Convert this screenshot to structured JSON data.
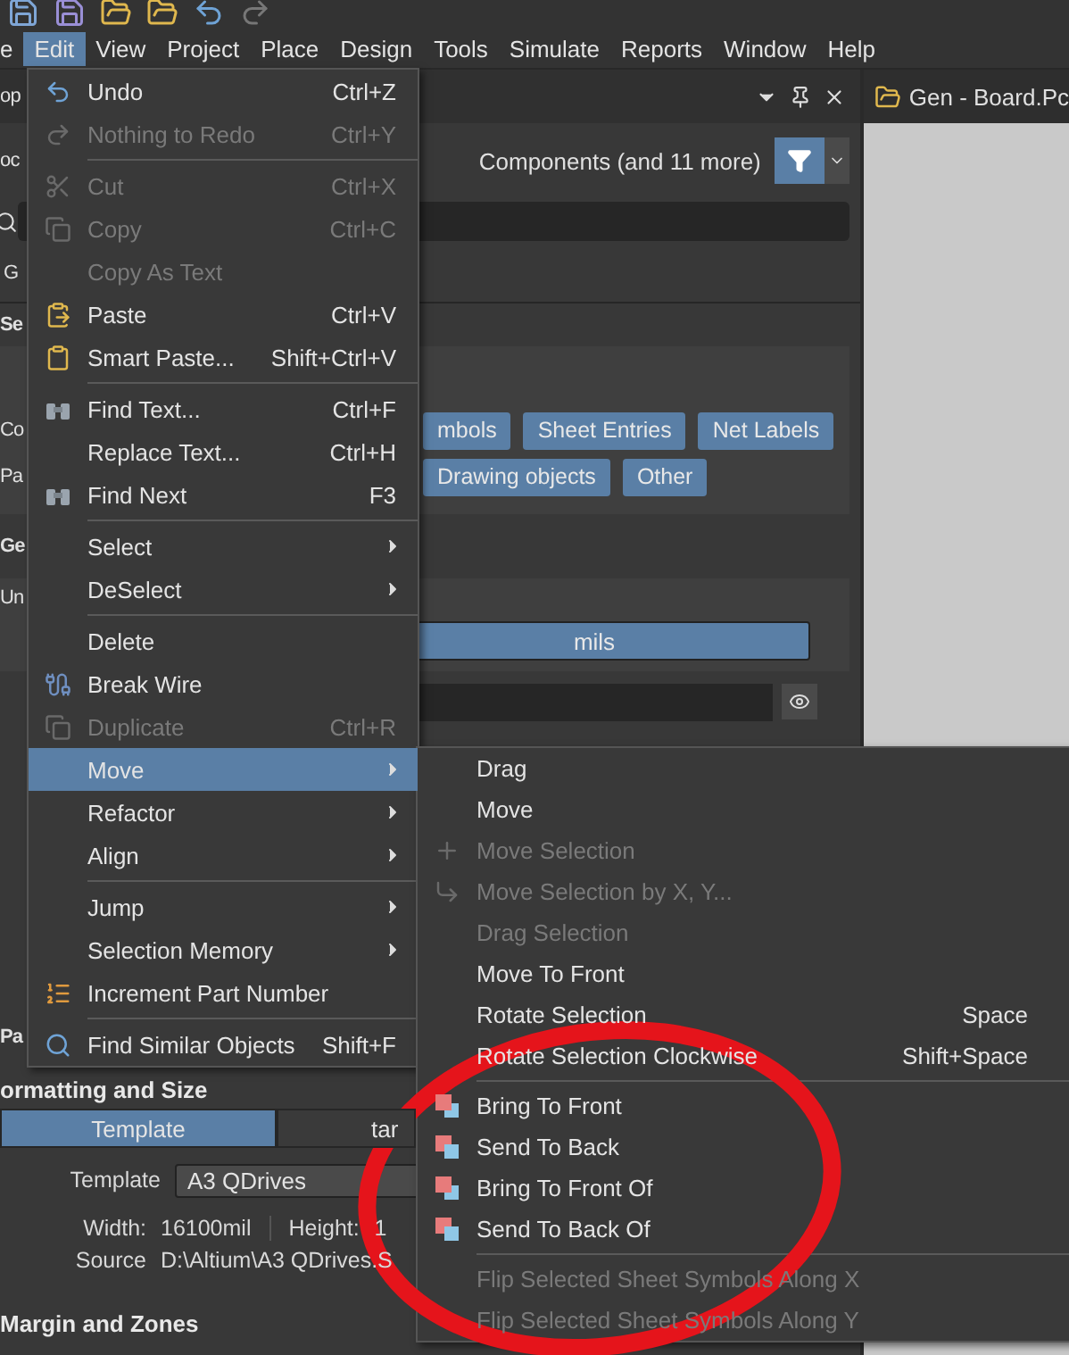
{
  "menubar": [
    {
      "label": "e",
      "selected": false
    },
    {
      "label": "Edit",
      "selected": true
    },
    {
      "label": "View",
      "selected": false
    },
    {
      "label": "Project",
      "selected": false
    },
    {
      "label": "Place",
      "selected": false
    },
    {
      "label": "Design",
      "selected": false
    },
    {
      "label": "Tools",
      "selected": false
    },
    {
      "label": "Simulate",
      "selected": false
    },
    {
      "label": "Reports",
      "selected": false
    },
    {
      "label": "Window",
      "selected": false
    },
    {
      "label": "Help",
      "selected": false
    }
  ],
  "properties_panel": {
    "title": "op",
    "filter_label": "oc",
    "filter_summary": "Components (and 11 more)",
    "general_tab": "G",
    "selection_heading": "Se",
    "object_rows": [
      {
        "fragment": "Co",
        "buttons": [
          "mbols",
          "Sheet Entries",
          "Net Labels"
        ]
      },
      {
        "fragment": "Pa",
        "buttons": [
          "Drawing objects",
          "Other"
        ]
      }
    ],
    "general_heading": "Ge",
    "units_label": "Un",
    "units_value": "mils",
    "page_heading": "Pa",
    "formatting_heading": "ormatting and Size",
    "format_tabs": [
      {
        "label": "Template",
        "selected": true
      },
      {
        "label": "tar",
        "selected": false
      }
    ],
    "template_label": "Template",
    "template_value": "A3 QDrives",
    "width_label": "Width:",
    "width_value": "16100mil",
    "height_label": "Height:",
    "height_value": "1",
    "source_label": "Source",
    "source_value": "D:\\Altium\\A3 QDrives.S",
    "margin_heading": "Margin and Zones"
  },
  "document_tab": {
    "title": "Gen - Board.Pc"
  },
  "edit_menu": [
    {
      "kind": "command",
      "label": "Undo",
      "shortcut": "Ctrl+Z",
      "disabled": false,
      "selected": false
    },
    {
      "kind": "command",
      "label": "Nothing to Redo",
      "shortcut": "Ctrl+Y",
      "disabled": true,
      "selected": false
    },
    {
      "kind": "separator"
    },
    {
      "kind": "command",
      "label": "Cut",
      "shortcut": "Ctrl+X",
      "disabled": true,
      "selected": false
    },
    {
      "kind": "command",
      "label": "Copy",
      "shortcut": "Ctrl+C",
      "disabled": true,
      "selected": false
    },
    {
      "kind": "command",
      "label": "Copy As Text",
      "disabled": true,
      "selected": false
    },
    {
      "kind": "command",
      "label": "Paste",
      "shortcut": "Ctrl+V",
      "disabled": false,
      "selected": false
    },
    {
      "kind": "command",
      "label": "Smart Paste...",
      "shortcut": "Shift+Ctrl+V",
      "disabled": false,
      "selected": false
    },
    {
      "kind": "separator"
    },
    {
      "kind": "command",
      "label": "Find Text...",
      "shortcut": "Ctrl+F",
      "disabled": false,
      "selected": false
    },
    {
      "kind": "command",
      "label": "Replace Text...",
      "shortcut": "Ctrl+H",
      "disabled": false,
      "selected": false
    },
    {
      "kind": "command",
      "label": "Find Next",
      "shortcut": "F3",
      "disabled": false,
      "selected": false
    },
    {
      "kind": "separator"
    },
    {
      "kind": "submenu",
      "label": "Select",
      "disabled": false,
      "selected": false
    },
    {
      "kind": "submenu",
      "label": "DeSelect",
      "disabled": false,
      "selected": false
    },
    {
      "kind": "separator"
    },
    {
      "kind": "command",
      "label": "Delete",
      "disabled": false,
      "selected": false
    },
    {
      "kind": "command",
      "label": "Break Wire",
      "disabled": false,
      "selected": false
    },
    {
      "kind": "command",
      "label": "Duplicate",
      "shortcut": "Ctrl+R",
      "disabled": true,
      "selected": false
    },
    {
      "kind": "submenu",
      "label": "Move",
      "disabled": false,
      "selected": true
    },
    {
      "kind": "submenu",
      "label": "Refactor",
      "disabled": false,
      "selected": false
    },
    {
      "kind": "submenu",
      "label": "Align",
      "disabled": false,
      "selected": false
    },
    {
      "kind": "separator"
    },
    {
      "kind": "submenu",
      "label": "Jump",
      "disabled": false,
      "selected": false
    },
    {
      "kind": "submenu",
      "label": "Selection Memory",
      "disabled": false,
      "selected": false
    },
    {
      "kind": "command",
      "label": "Increment Part Number",
      "disabled": false,
      "selected": false
    },
    {
      "kind": "separator"
    },
    {
      "kind": "command",
      "label": "Find Similar Objects",
      "shortcut": "Shift+F",
      "disabled": false,
      "selected": false
    }
  ],
  "move_submenu": [
    {
      "kind": "command",
      "label": "Drag",
      "disabled": false,
      "selected": false
    },
    {
      "kind": "command",
      "label": "Move",
      "disabled": false,
      "selected": false
    },
    {
      "kind": "command",
      "label": "Move Selection",
      "disabled": true,
      "selected": false
    },
    {
      "kind": "command",
      "label": "Move Selection by X, Y...",
      "disabled": true,
      "selected": false
    },
    {
      "kind": "command",
      "label": "Drag Selection",
      "disabled": true,
      "selected": false
    },
    {
      "kind": "command",
      "label": "Move To Front",
      "disabled": false,
      "selected": false
    },
    {
      "kind": "command",
      "label": "Rotate Selection",
      "shortcut": "Space",
      "disabled": false,
      "selected": false
    },
    {
      "kind": "command",
      "label": "Rotate Selection Clockwise",
      "shortcut": "Shift+Space",
      "disabled": false,
      "selected": false
    },
    {
      "kind": "separator"
    },
    {
      "kind": "command",
      "label": "Bring To Front",
      "disabled": false,
      "selected": false
    },
    {
      "kind": "command",
      "label": "Send To Back",
      "disabled": false,
      "selected": false
    },
    {
      "kind": "command",
      "label": "Bring To Front Of",
      "disabled": false,
      "selected": false
    },
    {
      "kind": "command",
      "label": "Send To Back Of",
      "disabled": false,
      "selected": false
    },
    {
      "kind": "separator"
    },
    {
      "kind": "command",
      "label": "Flip Selected Sheet Symbols Along X",
      "disabled": true,
      "selected": false
    },
    {
      "kind": "command",
      "label": "Flip Selected Sheet Symbols Along Y",
      "disabled": true,
      "selected": false
    }
  ]
}
